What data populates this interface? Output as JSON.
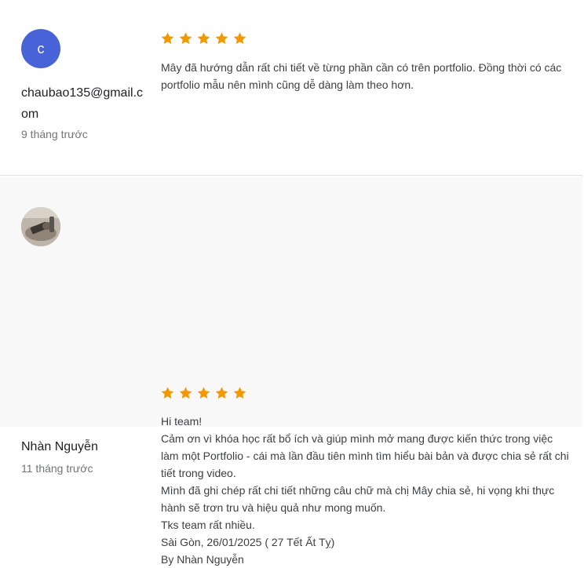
{
  "colors": {
    "star": "#f29900",
    "avatar_bg": "#4862d8"
  },
  "reviews": [
    {
      "avatar_initial": "c",
      "author": "chaubao135@gmail.com",
      "date": "9 tháng trước",
      "rating": 5,
      "lines": [
        "Mây đã hướng dẫn rất chi tiết về từng phần cần có trên portfolio. Đồng thời có các portfolio mẫu nên mình cũng dễ dàng làm theo hơn."
      ]
    },
    {
      "avatar_icon": "user-photo-avatar",
      "author": "Nhàn Nguyễn",
      "date": "11 tháng trước",
      "rating": 5,
      "lines": [
        "Hi team!",
        "Cảm ơn vì khóa học rất bổ ích và giúp mình mở mang được kiến thức trong việc làm một Portfolio - cái mà lần đầu tiên mình tìm hiểu bài bản và được chia sẻ rất chi tiết trong video.",
        "Mình đã ghi chép rất chi tiết những câu chữ mà chị Mây chia sẻ, hi vọng khi thực hành sẽ trơn tru và hiệu quả như mong muốn.",
        "Tks team rất nhiều.",
        "Sài Gòn, 26/01/2025 ( 27 Tết Ất Tỵ)",
        "By Nhàn Nguyễn"
      ]
    }
  ]
}
